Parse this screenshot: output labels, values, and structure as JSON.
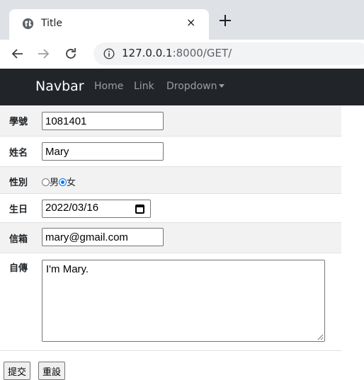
{
  "browser": {
    "tab_title": "Title",
    "tab_close": "×",
    "url_host": "127.0.0.1",
    "url_path": ":8000/GET/"
  },
  "navbar": {
    "brand": "Navbar",
    "links": [
      "Home",
      "Link",
      "Dropdown"
    ]
  },
  "form": {
    "student_id": {
      "label": "學號",
      "value": "1081401"
    },
    "name": {
      "label": "姓名",
      "value": "Mary"
    },
    "gender": {
      "label": "性別",
      "options": [
        "男",
        "女"
      ],
      "selected": "女"
    },
    "birthday": {
      "label": "生日",
      "value": "2022/03/16"
    },
    "email": {
      "label": "信箱",
      "value": "mary@gmail.com"
    },
    "bio": {
      "label": "自傳",
      "value": "I'm Mary."
    }
  },
  "buttons": {
    "submit": "提交",
    "reset": "重設"
  },
  "colors": {
    "navbar_bg": "#212529",
    "radio_accent": "#0075ff",
    "row_stripe": "#f2f2f2"
  }
}
